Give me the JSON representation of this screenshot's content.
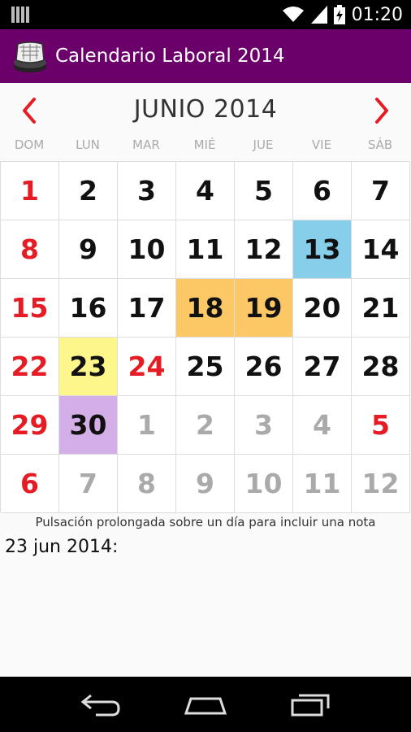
{
  "status_bar": {
    "time": "01:20",
    "icons": [
      "barcode-icon",
      "wifi-icon",
      "signal-icon",
      "battery-charging-icon"
    ]
  },
  "app": {
    "title": "Calendario Laboral 2014",
    "icon": "app-logo-icon"
  },
  "calendar": {
    "month_title": "JUNIO 2014",
    "prev_icon": "chevron-left-icon",
    "next_icon": "chevron-right-icon",
    "weekdays": [
      "DOM",
      "LUN",
      "MAR",
      "MIÉ",
      "JUE",
      "VIE",
      "SÁB"
    ],
    "days": [
      {
        "n": "1",
        "t": "holiday"
      },
      {
        "n": "2"
      },
      {
        "n": "3"
      },
      {
        "n": "4"
      },
      {
        "n": "5"
      },
      {
        "n": "6"
      },
      {
        "n": "7"
      },
      {
        "n": "8",
        "t": "holiday"
      },
      {
        "n": "9"
      },
      {
        "n": "10"
      },
      {
        "n": "11"
      },
      {
        "n": "12"
      },
      {
        "n": "13",
        "bg": "#87ceeb"
      },
      {
        "n": "14"
      },
      {
        "n": "15",
        "t": "holiday"
      },
      {
        "n": "16"
      },
      {
        "n": "17"
      },
      {
        "n": "18",
        "bg": "#fcc865"
      },
      {
        "n": "19",
        "bg": "#fcc865"
      },
      {
        "n": "20"
      },
      {
        "n": "21"
      },
      {
        "n": "22",
        "t": "holiday"
      },
      {
        "n": "23",
        "bg": "#fdf68a"
      },
      {
        "n": "24",
        "t": "holiday"
      },
      {
        "n": "25"
      },
      {
        "n": "26"
      },
      {
        "n": "27"
      },
      {
        "n": "28"
      },
      {
        "n": "29",
        "t": "holiday"
      },
      {
        "n": "30",
        "bg": "#d4aee6"
      },
      {
        "n": "1",
        "t": "other"
      },
      {
        "n": "2",
        "t": "other"
      },
      {
        "n": "3",
        "t": "other"
      },
      {
        "n": "4",
        "t": "other"
      },
      {
        "n": "5",
        "t": "holiday"
      },
      {
        "n": "6",
        "t": "holiday"
      },
      {
        "n": "7",
        "t": "other"
      },
      {
        "n": "8",
        "t": "other"
      },
      {
        "n": "9",
        "t": "other"
      },
      {
        "n": "10",
        "t": "other"
      },
      {
        "n": "11",
        "t": "other"
      },
      {
        "n": "12",
        "t": "other"
      }
    ]
  },
  "hint": "Pulsación prolongada sobre un día para incluir una nota",
  "note": {
    "date_label": "23 jun 2014:"
  },
  "nav_bar": {
    "back": "back-icon",
    "home": "home-icon",
    "recents": "recents-icon"
  },
  "colors": {
    "action_bar": "#6b006b",
    "holiday": "#e51c23",
    "muted": "#aaaaaa"
  }
}
